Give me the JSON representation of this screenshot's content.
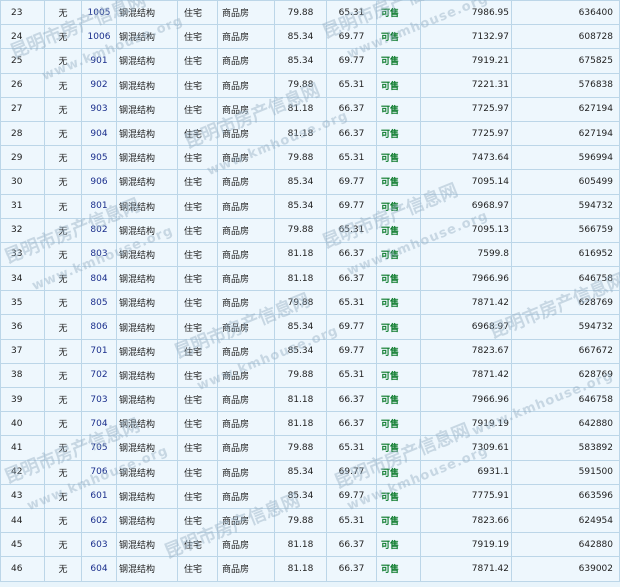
{
  "columns_count": 11,
  "rows": [
    [
      "23",
      "无",
      "1005",
      "钢混结构",
      "住宅",
      "商品房",
      "79.88",
      "65.31",
      "可售",
      "7986.95",
      "636400"
    ],
    [
      "24",
      "无",
      "1006",
      "钢混结构",
      "住宅",
      "商品房",
      "85.34",
      "69.77",
      "可售",
      "7132.97",
      "608728"
    ],
    [
      "25",
      "无",
      "901",
      "钢混结构",
      "住宅",
      "商品房",
      "85.34",
      "69.77",
      "可售",
      "7919.21",
      "675825"
    ],
    [
      "26",
      "无",
      "902",
      "钢混结构",
      "住宅",
      "商品房",
      "79.88",
      "65.31",
      "可售",
      "7221.31",
      "576838"
    ],
    [
      "27",
      "无",
      "903",
      "钢混结构",
      "住宅",
      "商品房",
      "81.18",
      "66.37",
      "可售",
      "7725.97",
      "627194"
    ],
    [
      "28",
      "无",
      "904",
      "钢混结构",
      "住宅",
      "商品房",
      "81.18",
      "66.37",
      "可售",
      "7725.97",
      "627194"
    ],
    [
      "29",
      "无",
      "905",
      "钢混结构",
      "住宅",
      "商品房",
      "79.88",
      "65.31",
      "可售",
      "7473.64",
      "596994"
    ],
    [
      "30",
      "无",
      "906",
      "钢混结构",
      "住宅",
      "商品房",
      "85.34",
      "69.77",
      "可售",
      "7095.14",
      "605499"
    ],
    [
      "31",
      "无",
      "801",
      "钢混结构",
      "住宅",
      "商品房",
      "85.34",
      "69.77",
      "可售",
      "6968.97",
      "594732"
    ],
    [
      "32",
      "无",
      "802",
      "钢混结构",
      "住宅",
      "商品房",
      "79.88",
      "65.31",
      "可售",
      "7095.13",
      "566759"
    ],
    [
      "33",
      "无",
      "803",
      "钢混结构",
      "住宅",
      "商品房",
      "81.18",
      "66.37",
      "可售",
      "7599.8",
      "616952"
    ],
    [
      "34",
      "无",
      "804",
      "钢混结构",
      "住宅",
      "商品房",
      "81.18",
      "66.37",
      "可售",
      "7966.96",
      "646758"
    ],
    [
      "35",
      "无",
      "805",
      "钢混结构",
      "住宅",
      "商品房",
      "79.88",
      "65.31",
      "可售",
      "7871.42",
      "628769"
    ],
    [
      "36",
      "无",
      "806",
      "钢混结构",
      "住宅",
      "商品房",
      "85.34",
      "69.77",
      "可售",
      "6968.97",
      "594732"
    ],
    [
      "37",
      "无",
      "701",
      "钢混结构",
      "住宅",
      "商品房",
      "85.34",
      "69.77",
      "可售",
      "7823.67",
      "667672"
    ],
    [
      "38",
      "无",
      "702",
      "钢混结构",
      "住宅",
      "商品房",
      "79.88",
      "65.31",
      "可售",
      "7871.42",
      "628769"
    ],
    [
      "39",
      "无",
      "703",
      "钢混结构",
      "住宅",
      "商品房",
      "81.18",
      "66.37",
      "可售",
      "7966.96",
      "646758"
    ],
    [
      "40",
      "无",
      "704",
      "钢混结构",
      "住宅",
      "商品房",
      "81.18",
      "66.37",
      "可售",
      "7919.19",
      "642880"
    ],
    [
      "41",
      "无",
      "705",
      "钢混结构",
      "住宅",
      "商品房",
      "79.88",
      "65.31",
      "可售",
      "7309.61",
      "583892"
    ],
    [
      "42",
      "无",
      "706",
      "钢混结构",
      "住宅",
      "商品房",
      "85.34",
      "69.77",
      "可售",
      "6931.1",
      "591500"
    ],
    [
      "43",
      "无",
      "601",
      "钢混结构",
      "住宅",
      "商品房",
      "85.34",
      "69.77",
      "可售",
      "7775.91",
      "663596"
    ],
    [
      "44",
      "无",
      "602",
      "钢混结构",
      "住宅",
      "商品房",
      "79.88",
      "65.31",
      "可售",
      "7823.66",
      "624954"
    ],
    [
      "45",
      "无",
      "603",
      "钢混结构",
      "住宅",
      "商品房",
      "81.18",
      "66.37",
      "可售",
      "7919.19",
      "642880"
    ],
    [
      "46",
      "无",
      "604",
      "钢混结构",
      "住宅",
      "商品房",
      "81.18",
      "66.37",
      "可售",
      "7871.42",
      "639002"
    ]
  ],
  "watermark": {
    "cn": "昆明市房产信息网",
    "url": "www.kmhouse.org"
  },
  "colors": {
    "room_link": "#1a2e8c",
    "status_available": "#0a7a2a",
    "grid_line": "#bcd6e8",
    "cell_bg": "#eef7fd"
  }
}
